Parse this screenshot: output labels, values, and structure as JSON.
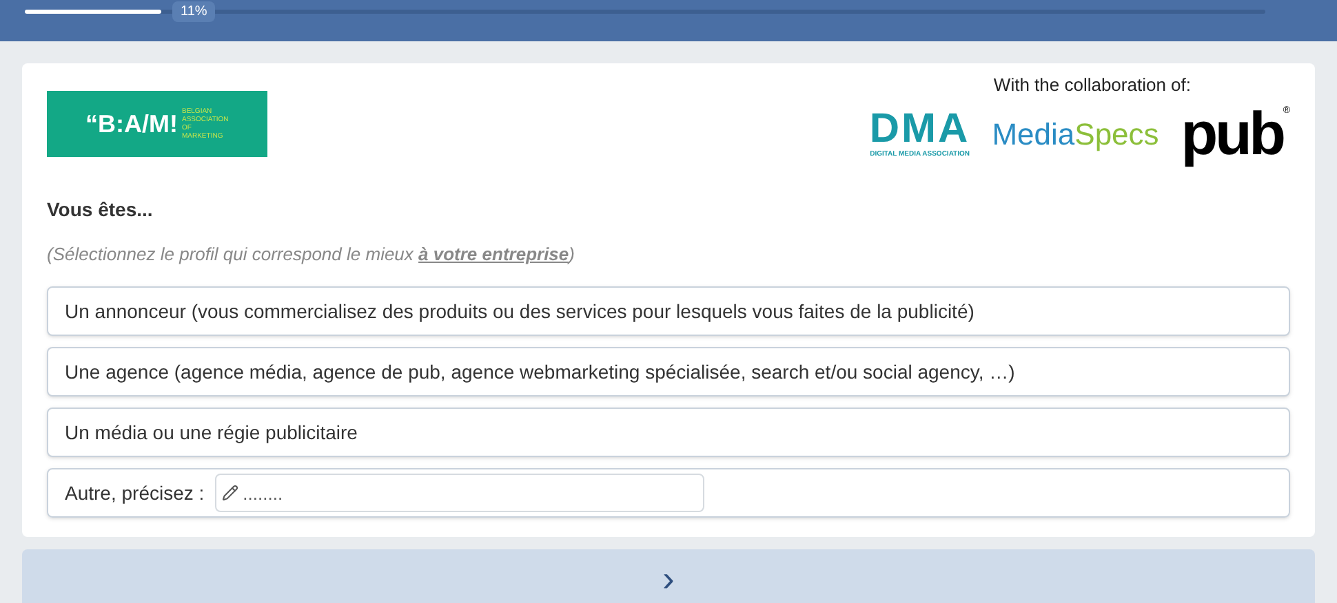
{
  "progress": {
    "level": 0.11,
    "label": "11%"
  },
  "header": {
    "logo_left": {
      "mark": "“B:A/M!",
      "text": "BELGIAN ASSOCIATION OF MARKETING"
    },
    "collab_label": "With the collaboration of:",
    "logos": [
      {
        "kind": "dma",
        "mark": "DMA",
        "text": "DIGITAL MEDIA ASSOCIATION"
      },
      {
        "kind": "mediaspecs",
        "mark": "Media",
        "text": "Specs"
      },
      {
        "kind": "pub",
        "mark": "pub",
        "text": "®"
      }
    ]
  },
  "question": {
    "title": "Vous êtes...",
    "hint": "(Sélectionnez le profil qui correspond le mieux **à votre entreprise**)"
  },
  "options": [
    {
      "kind": "choice",
      "label": "Un annonceur (vous commercialisez des produits ou des services pour lesquels vous faites de la publicité)"
    },
    {
      "kind": "choice",
      "label": "Une agence (agence média, agence de pub, agence webmarketing spécialisée, search et/ou social agency, …)"
    },
    {
      "kind": "choice",
      "label": "Un média ou une régie publicitaire"
    },
    {
      "kind": "other",
      "label": "Autre, précisez :",
      "placeholder": "........"
    }
  ],
  "next_button": {
    "label": "›"
  }
}
